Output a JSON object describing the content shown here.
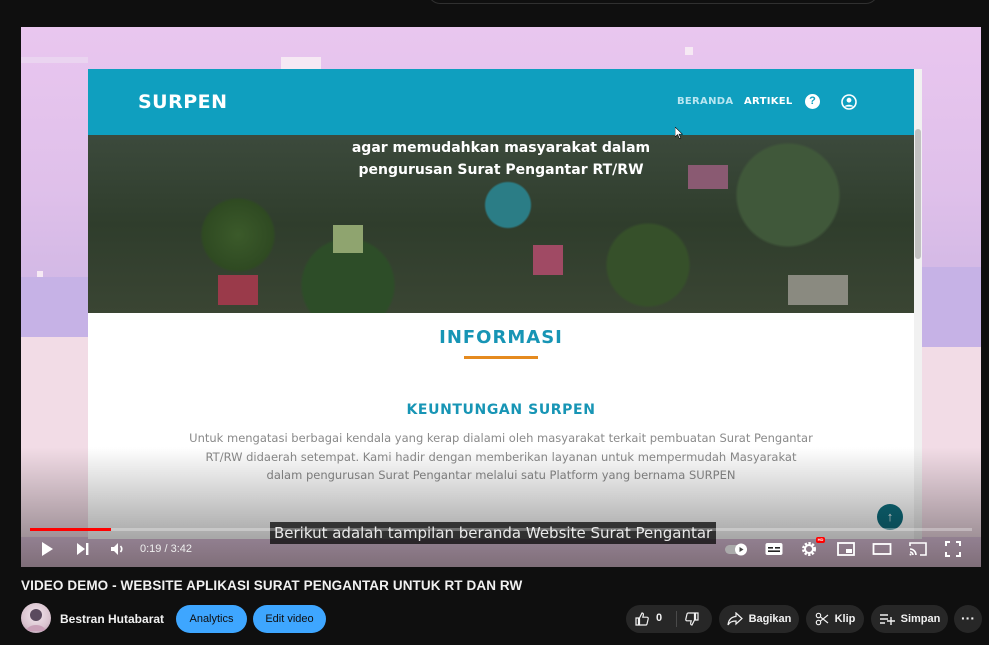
{
  "player": {
    "website": {
      "brand": "SURPEN",
      "nav": {
        "beranda": "BERANDA",
        "artikel": "ARTIKEL",
        "help_glyph": "?"
      },
      "hero": {
        "line1": "agar memudahkan masyarakat dalam",
        "line2": "pengurusan Surat Pengantar RT/RW"
      },
      "section_title": "INFORMASI",
      "subsection_title": "KEUNTUNGAN SURPEN",
      "subsection_body": "Untuk mengatasi berbagai kendala yang kerap dialami oleh masyarakat terkait pembuatan Surat Pengantar RT/RW didaerah setempat. Kami hadir dengan memberikan layanan untuk mempermudah Masyarakat dalam pengurusan Surat Pengantar melalui satu Platform yang bernama SURPEN",
      "back_to_top_glyph": "↑",
      "accent_color": "#0f9fbf",
      "underline_color": "#e58a1f"
    },
    "caption": "Berikut adalah tampilan beranda Website Surat Pengantar",
    "time": "0:19 / 3:42",
    "progress": 0.086,
    "progress_color": "#ff0000",
    "hd_badge": "HD",
    "icons": [
      "play-icon",
      "next-icon",
      "volume-icon",
      "autoplay-toggle-icon",
      "subtitles-icon",
      "settings-icon",
      "miniplayer-icon",
      "theater-icon",
      "cast-icon",
      "fullscreen-icon"
    ]
  },
  "video": {
    "title": "VIDEO DEMO - WEBSITE APLIKASI SURAT PENGANTAR UNTUK RT DAN RW",
    "channel": "Bestran Hutabarat",
    "analytics_label": "Analytics",
    "edit_label": "Edit video",
    "likes": "0",
    "share_label": "Bagikan",
    "clip_label": "Klip",
    "save_label": "Simpan",
    "more_glyph": "···"
  }
}
